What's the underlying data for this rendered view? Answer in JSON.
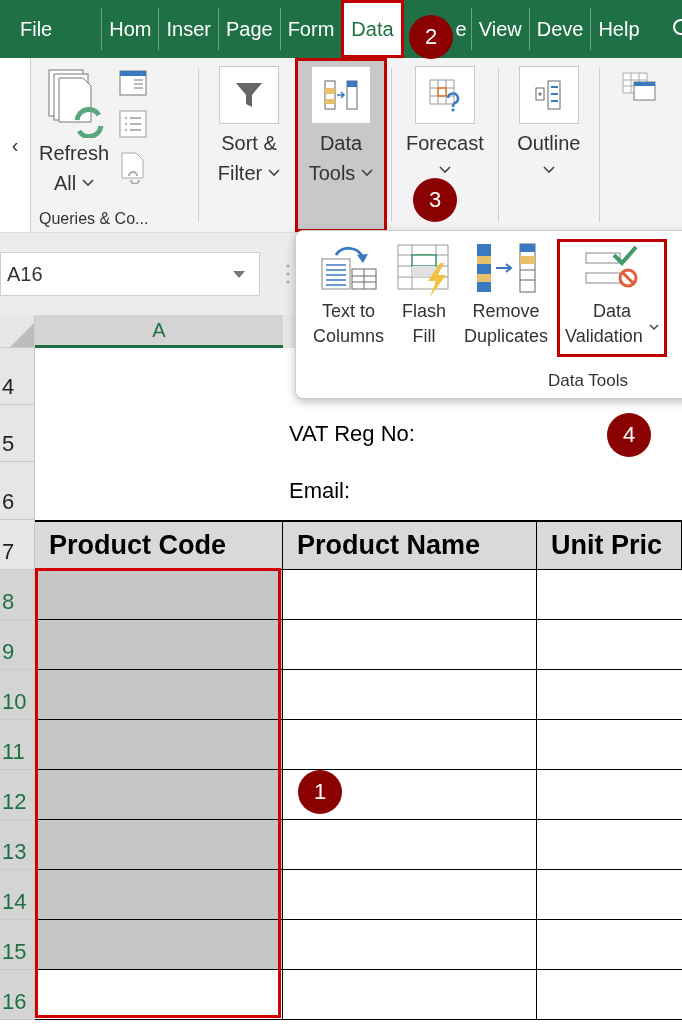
{
  "tabs": [
    {
      "label": "File",
      "selected": false,
      "highlighted": false,
      "covered": false
    },
    {
      "label": "Hom",
      "selected": false,
      "highlighted": false,
      "covered": false
    },
    {
      "label": "Inser",
      "selected": false,
      "highlighted": false,
      "covered": false
    },
    {
      "label": "Page",
      "selected": false,
      "highlighted": false,
      "covered": false
    },
    {
      "label": "Form",
      "selected": false,
      "highlighted": false,
      "covered": false
    },
    {
      "label": "Data",
      "selected": true,
      "highlighted": true,
      "covered": false
    },
    {
      "label": "e",
      "selected": false,
      "highlighted": false,
      "covered": true
    },
    {
      "label": "View",
      "selected": false,
      "highlighted": false,
      "covered": false
    },
    {
      "label": "Deve",
      "selected": false,
      "highlighted": false,
      "covered": false
    },
    {
      "label": "Help",
      "selected": false,
      "highlighted": false,
      "covered": false
    }
  ],
  "ribbon": {
    "collapse": "‹",
    "queries": {
      "lines": [
        "Refresh",
        "All"
      ],
      "dropdown": true,
      "label": "Queries & Co..."
    },
    "buttons": [
      {
        "kind": "sort-filter",
        "lines": [
          "Sort &",
          "Filter"
        ],
        "dropdown": true,
        "selected": false,
        "highlighted": false,
        "separator_after": false
      },
      {
        "kind": "data-tools",
        "lines": [
          "Data",
          "Tools"
        ],
        "dropdown": true,
        "selected": true,
        "highlighted": true,
        "separator_after": true
      },
      {
        "kind": "forecast",
        "lines": [
          "Forecast"
        ],
        "dropdown": true,
        "selected": false,
        "highlighted": false,
        "separator_after": true
      },
      {
        "kind": "outline",
        "lines": [
          "Outline"
        ],
        "dropdown": true,
        "selected": false,
        "highlighted": false,
        "separator_after": true
      }
    ]
  },
  "name_box": {
    "value": "A16"
  },
  "column_headers": [
    {
      "label": "A",
      "selected": true
    }
  ],
  "rows": [
    {
      "number": "4",
      "selected": false,
      "kind": "info"
    },
    {
      "number": "5",
      "selected": false,
      "kind": "info",
      "text": "VAT Reg No:"
    },
    {
      "number": "6",
      "selected": false,
      "kind": "info",
      "text": "Email:"
    },
    {
      "number": "7",
      "selected": false,
      "kind": "header",
      "cells": [
        "Product Code",
        "Product Name",
        "Unit Pric"
      ]
    },
    {
      "number": "8",
      "selected": true,
      "kind": "data",
      "highlighted": true
    },
    {
      "number": "9",
      "selected": true,
      "kind": "data",
      "highlighted": true
    },
    {
      "number": "10",
      "selected": true,
      "kind": "data",
      "highlighted": true
    },
    {
      "number": "11",
      "selected": true,
      "kind": "data",
      "highlighted": true
    },
    {
      "number": "12",
      "selected": true,
      "kind": "data",
      "highlighted": true
    },
    {
      "number": "13",
      "selected": true,
      "kind": "data",
      "highlighted": true
    },
    {
      "number": "14",
      "selected": true,
      "kind": "data",
      "highlighted": true
    },
    {
      "number": "15",
      "selected": true,
      "kind": "data",
      "highlighted": true
    },
    {
      "number": "16",
      "selected": true,
      "kind": "data",
      "highlighted": false
    }
  ],
  "selection_outlined": true,
  "data_tools_menu": {
    "items": [
      {
        "kind": "text-to-columns",
        "lines": [
          "Text to",
          "Columns"
        ],
        "dropdown": false,
        "highlighted": false
      },
      {
        "kind": "flash-fill",
        "lines": [
          "Flash",
          "Fill"
        ],
        "dropdown": false,
        "highlighted": false
      },
      {
        "kind": "remove-duplicates",
        "lines": [
          "Remove",
          "Duplicates"
        ],
        "dropdown": false,
        "highlighted": false
      },
      {
        "kind": "data-validation",
        "lines": [
          "Data",
          "Validation"
        ],
        "dropdown": true,
        "highlighted": true
      }
    ],
    "label": "Data Tools"
  },
  "markers": [
    {
      "number": "2"
    },
    {
      "number": "3"
    },
    {
      "number": "4"
    },
    {
      "number": "1"
    }
  ]
}
